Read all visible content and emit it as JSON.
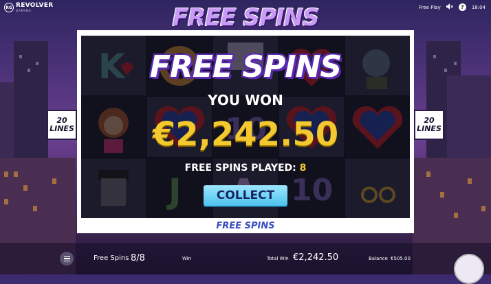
{
  "brand": {
    "name": "REVOLVER",
    "sub": "GAMING",
    "badge": "RG"
  },
  "topbar": {
    "mode": "Free Play",
    "time": "18:04",
    "help": "?"
  },
  "game_title": "FREE SPINS",
  "paylines": {
    "left": {
      "num": "20",
      "word": "LINES"
    },
    "right": {
      "num": "20",
      "word": "LINES"
    }
  },
  "frame_label": "FREE SPINS",
  "popup": {
    "title": "FREE SPINS",
    "you_won": "YOU WON",
    "amount": "€2,242.50",
    "played_label": "FREE SPINS PLAYED:",
    "played_value": "8",
    "collect": "COLLECT"
  },
  "bottombar": {
    "free_spins_label": "Free Spins",
    "free_spins_value": "8/8",
    "win_label": "Win",
    "total_win_label": "Total Win",
    "total_win_value": "€2,242.50",
    "balance_label": "Balance",
    "balance_value": "€505.00"
  },
  "colors": {
    "accent_gold": "#f3c92f",
    "collect_blue": "#4cc3ec",
    "title_purple": "#5b2ab0"
  }
}
